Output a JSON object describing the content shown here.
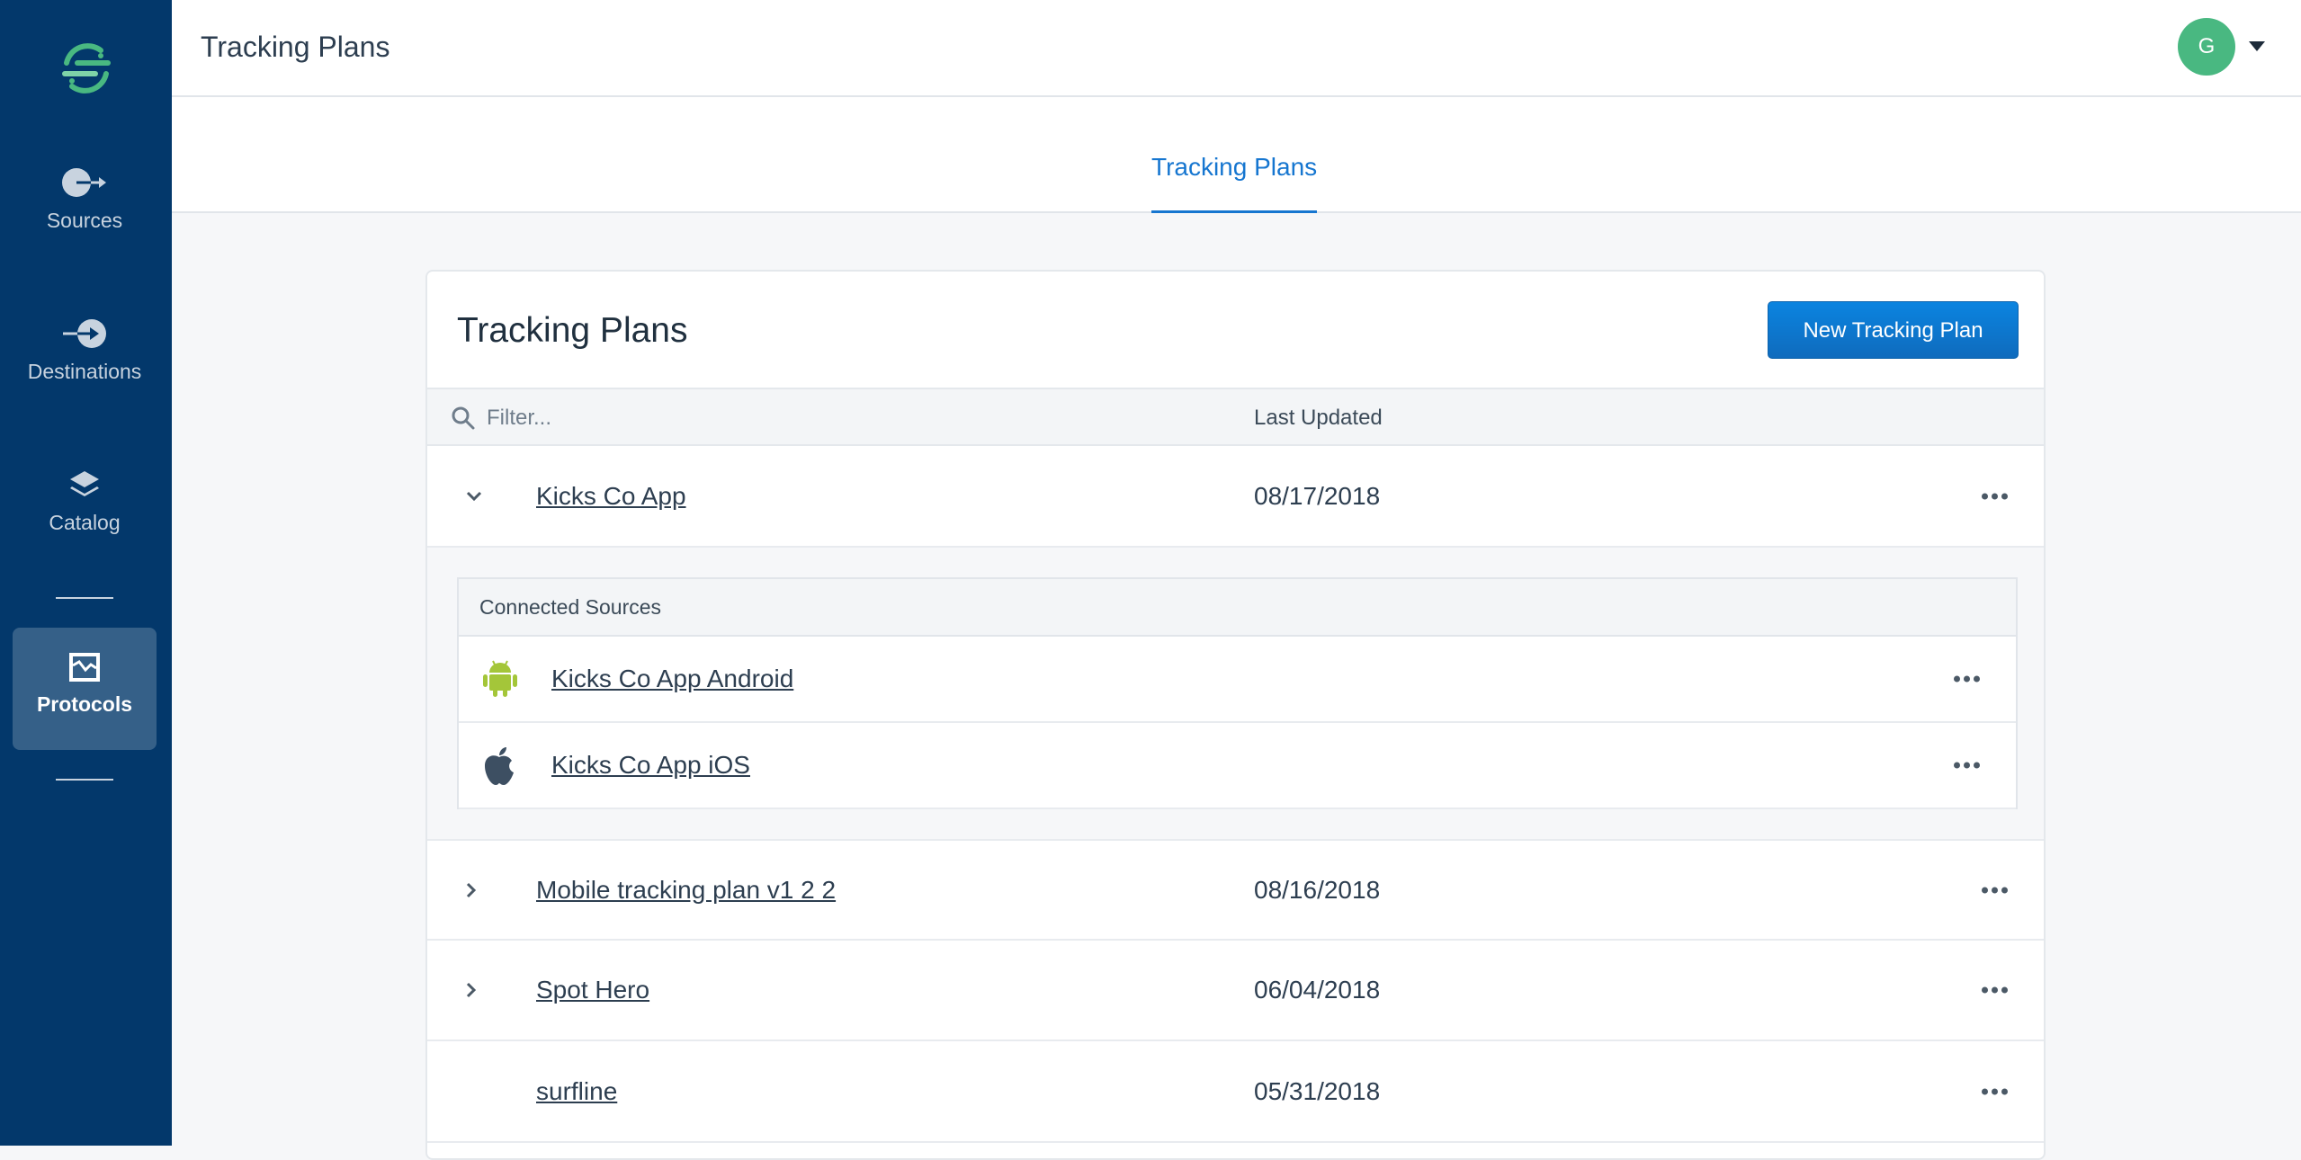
{
  "sidebar": {
    "items": [
      {
        "label": "Sources",
        "icon": "source-icon"
      },
      {
        "label": "Destinations",
        "icon": "destination-icon"
      },
      {
        "label": "Catalog",
        "icon": "layers-icon"
      },
      {
        "label": "Protocols",
        "icon": "protocols-icon",
        "active": true
      }
    ]
  },
  "header": {
    "title": "Tracking Plans",
    "avatar_initial": "G"
  },
  "tabs": [
    {
      "label": "Tracking Plans",
      "active": true
    }
  ],
  "card": {
    "title": "Tracking Plans",
    "new_button": "New Tracking Plan",
    "filter_placeholder": "Filter...",
    "col_last_updated": "Last Updated",
    "plans": [
      {
        "name": "Kicks Co App",
        "date": "08/17/2018",
        "expanded": true
      },
      {
        "name": "Mobile tracking plan v1 2 2",
        "date": "08/16/2018"
      },
      {
        "name": "Spot Hero",
        "date": "06/04/2018"
      },
      {
        "name": "surfline",
        "date": "05/31/2018"
      }
    ],
    "connected": {
      "title": "Connected Sources",
      "sources": [
        {
          "name": "Kicks Co App Android",
          "icon": "android-icon"
        },
        {
          "name": "Kicks Co App iOS",
          "icon": "apple-icon"
        }
      ]
    }
  },
  "colors": {
    "sidebar": "#03386b",
    "accent": "#1676d0",
    "brand_green": "#49b881"
  }
}
